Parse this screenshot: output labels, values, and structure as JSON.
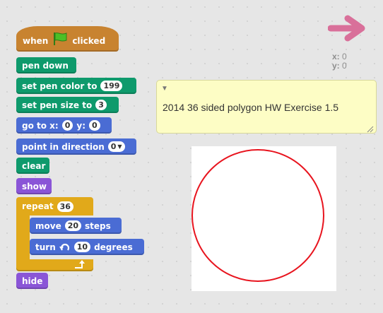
{
  "script": {
    "hat": {
      "when": "when",
      "clicked": "clicked"
    },
    "pen_down": "pen down",
    "set_pen_color": {
      "label": "set pen color to",
      "value": "199"
    },
    "set_pen_size": {
      "label": "set pen size to",
      "value": "3"
    },
    "go_to": {
      "label_go": "go to x:",
      "x": "0",
      "label_y": "y:",
      "y": "0"
    },
    "point_in_direction": {
      "label": "point in direction",
      "value": "0"
    },
    "clear": "clear",
    "show": "show",
    "repeat": {
      "label": "repeat",
      "value": "36"
    },
    "move": {
      "label": "move",
      "value": "20",
      "suffix": "steps"
    },
    "turn": {
      "label": "turn",
      "value": "10",
      "suffix": "degrees"
    },
    "hide": "hide"
  },
  "sprite_coords": {
    "x_label": "x:",
    "x": "0",
    "y_label": "y:",
    "y": "0"
  },
  "comment": {
    "text": "2014 36 sided polygon HW Exercise 1.5"
  },
  "colors": {
    "pen_block": "#0e9a6c",
    "motion_block": "#4a6cd4",
    "looks_block": "#8a55d7",
    "control_block": "#e1a91a",
    "events_block": "#c88330",
    "flag": "#4cbf26",
    "drawn_circle": "#e8141e",
    "arrow": "#d9709a"
  },
  "icons": [
    "green-flag-icon",
    "rotate-left-icon",
    "dropdown-arrow-icon",
    "loop-arrow-icon",
    "direction-arrow-icon",
    "comment-collapse-icon",
    "resize-grip-icon"
  ]
}
